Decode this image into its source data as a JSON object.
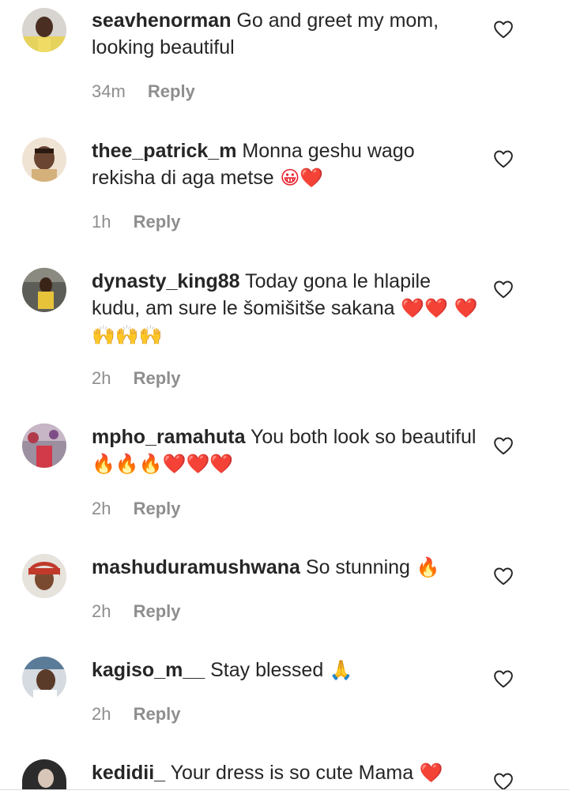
{
  "comments": [
    {
      "username": "seavhenorman",
      "text": "Go and greet my mom, looking beautiful",
      "emoji": "",
      "time": "34m",
      "reply": "Reply",
      "avatar_icon": "user-avatar",
      "avatar_color": "#e8d36a"
    },
    {
      "username": "thee_patrick_m",
      "text": "Monna geshu wago rekisha di aga metse",
      "emoji": " 😀❤️",
      "time": "1h",
      "reply": "Reply",
      "avatar_icon": "user-avatar",
      "avatar_color": "#c9a27a"
    },
    {
      "username": "dynasty_king88",
      "text": "Today gona le hlapile kudu, am sure le šomišitše sakana",
      "emoji": " ❤️❤️ ❤️🙌🙌🙌",
      "time": "2h",
      "reply": "Reply",
      "avatar_icon": "user-avatar",
      "avatar_color": "#3b3b3b"
    },
    {
      "username": "mpho_ramahuta",
      "text": "You both look so beautiful",
      "emoji": "🔥🔥🔥❤️❤️❤️",
      "time": "2h",
      "reply": "Reply",
      "avatar_icon": "user-avatar",
      "avatar_color": "#6b5a6e"
    },
    {
      "username": "mashuduramushwana",
      "text": "So stunning",
      "emoji": " 🔥",
      "time": "2h",
      "reply": "Reply",
      "avatar_icon": "user-avatar",
      "avatar_color": "#c0392b"
    },
    {
      "username": "kagiso_m__",
      "text": "Stay blessed",
      "emoji": " 🙏",
      "time": "2h",
      "reply": "Reply",
      "avatar_icon": "user-avatar",
      "avatar_color": "#5b7c99"
    },
    {
      "username": "kedidii_",
      "text": "Your dress is so cute Mama",
      "emoji": " ❤️",
      "time": "",
      "reply": "",
      "avatar_icon": "user-avatar",
      "avatar_color": "#2b2b2b"
    }
  ],
  "icons": {
    "like": "heart-outline-icon"
  }
}
